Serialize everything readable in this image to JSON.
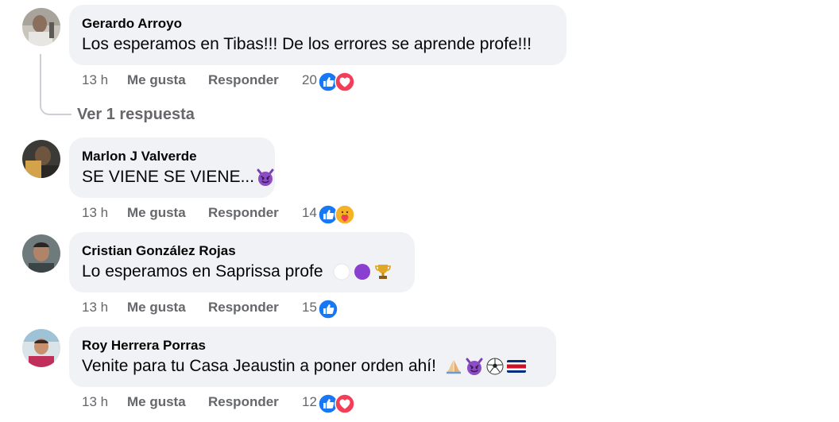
{
  "comments": [
    {
      "author": "Gerardo Arroyo",
      "text": "Los esperamos en Tibas!!! De los errores se aprende profe!!!",
      "time": "13 h",
      "like_label": "Me gusta",
      "reply_label": "Responder",
      "reaction_count": "20",
      "reactions": [
        "like-icon",
        "love-icon"
      ],
      "emojis": []
    },
    {
      "author": "Marlon J Valverde",
      "text": "SE VIENE SE VIENE...",
      "time": "13 h",
      "like_label": "Me gusta",
      "reply_label": "Responder",
      "reaction_count": "14",
      "reactions": [
        "like-icon",
        "care-icon"
      ],
      "emojis": [
        "smiling-devil-emoji"
      ]
    },
    {
      "author": "Cristian González Rojas",
      "text": "Lo esperamos en Saprissa profe",
      "time": "13 h",
      "like_label": "Me gusta",
      "reply_label": "Responder",
      "reaction_count": "15",
      "reactions": [
        "like-icon"
      ],
      "emojis": [
        "white-circle-emoji",
        "purple-circle-emoji",
        "trophy-emoji"
      ]
    },
    {
      "author": "Roy Herrera Porras",
      "text": "Venite para tu Casa Jeaustin a poner orden ahí!",
      "time": "13 h",
      "like_label": "Me gusta",
      "reply_label": "Responder",
      "reaction_count": "12",
      "reactions": [
        "like-icon",
        "love-icon"
      ],
      "emojis": [
        "folded-hands-emoji",
        "smiling-devil-emoji",
        "soccer-ball-emoji",
        "costa-rica-flag-emoji"
      ]
    }
  ],
  "view_replies_label": "Ver 1 respuesta",
  "colors": {
    "bubble": "#f0f2f5",
    "secondary_text": "#65676b",
    "primary_text": "#050505",
    "like_blue": "#1877f2",
    "love_red": "#f33e58",
    "care_yellow": "#f7b125"
  }
}
